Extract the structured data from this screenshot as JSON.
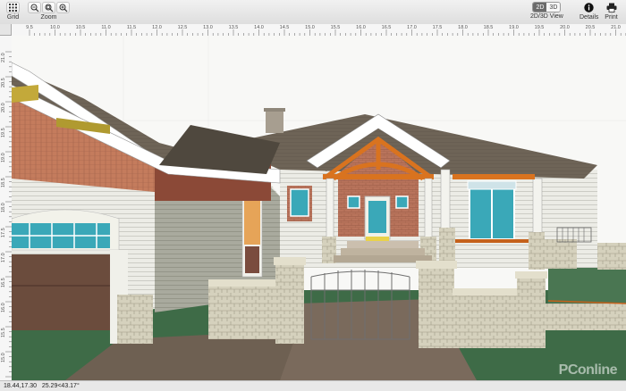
{
  "toolbar": {
    "grid_label": "Grid",
    "zoom_label": "Zoom",
    "view_2d": "2D",
    "view_3d": "3D",
    "view_label": "2D/3D View",
    "details_label": "Details",
    "print_label": "Print",
    "active_view": "2D"
  },
  "ruler": {
    "horizontal": [
      "9.5",
      "10.0",
      "10.5",
      "11.0",
      "11.5",
      "12.0",
      "12.5",
      "13.0",
      "13.5",
      "14.0",
      "14.5",
      "15.0",
      "15.5",
      "16.0",
      "16.5",
      "17.0",
      "17.5",
      "18.0",
      "18.5",
      "19.0",
      "19.5",
      "20.0",
      "20.5",
      "21.0"
    ],
    "vertical": [
      "21.0",
      "20.5",
      "20.0",
      "19.5",
      "19.0",
      "18.5",
      "18.0",
      "17.5",
      "17.0",
      "16.5",
      "16.0",
      "15.5",
      "15.0",
      "14.5"
    ]
  },
  "status": {
    "coordinates": "18.44,17.30",
    "angle": "25.29<43.17°"
  },
  "watermark": "PConline",
  "icons": [
    "grid-icon",
    "zoom-out-icon",
    "zoom-fit-icon",
    "zoom-in-icon",
    "info-icon",
    "printer-icon"
  ],
  "colors": {
    "active_segment": "#6b6b6b",
    "roof": "#6e6457",
    "timber": "#d9731f",
    "brick": "#b9745c",
    "lawn": "#3e6b47"
  }
}
